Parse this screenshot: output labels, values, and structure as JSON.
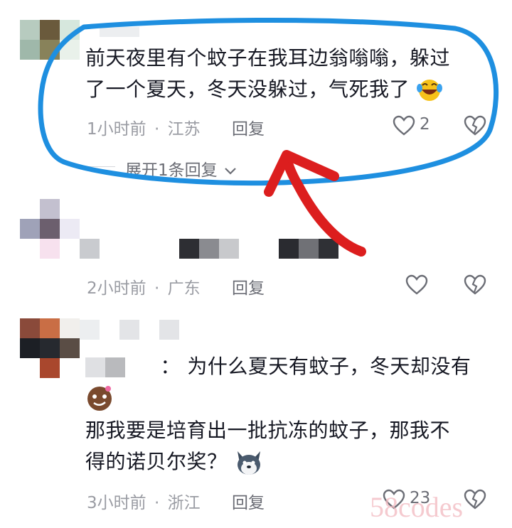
{
  "comments": [
    {
      "text_line1": "前天夜里有个蚊子在我耳边翁嗡嗡，躲过",
      "text_line2": "了一个夏天，冬天没躲过，气死我了",
      "emoji": "laughing-crying-emoji",
      "time": "1小时前",
      "separator": "·",
      "location": "江苏",
      "reply_label": "回复",
      "like_count": "2",
      "expand_label": "展开1条回复"
    },
    {
      "time": "2小时前",
      "separator": "·",
      "location": "广东",
      "reply_label": "回复"
    },
    {
      "quote_prefix": "：",
      "quote_text": "为什么夏天有蚊子，冬天却没有",
      "text_line1": "那我要是培育出一批抗冻的蚊子，那我不",
      "text_line2": "得的诺贝尔奖？",
      "time": "3小时前",
      "separator": "·",
      "location": "浙江",
      "reply_label": "回复",
      "like_count": "23"
    }
  ],
  "watermark": "58codes",
  "colors": {
    "annotation_blue": "#1e8fe0",
    "annotation_red": "#dc1e1e",
    "meta_gray": "#9a9ca3"
  },
  "icons": [
    "heart-outline-icon",
    "broken-heart-icon",
    "chevron-down-icon"
  ]
}
